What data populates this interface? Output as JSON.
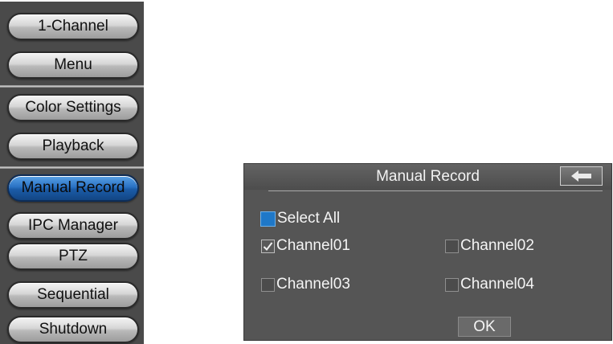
{
  "menu": {
    "items": [
      {
        "label": "1-Channel"
      },
      {
        "label": "Menu"
      },
      {
        "label": "Color Settings"
      },
      {
        "label": "Playback"
      },
      {
        "label": "Manual Record",
        "active": true
      },
      {
        "label": "IPC Manager"
      },
      {
        "label": "PTZ"
      },
      {
        "label": "Sequential"
      },
      {
        "label": "Shutdown"
      }
    ],
    "active_color": "#2a72c4"
  },
  "dialog": {
    "title": "Manual Record",
    "back_icon": "back-arrow-icon",
    "select_all": {
      "label": "Select All",
      "checked": false
    },
    "channels": [
      {
        "label": "Channel01",
        "checked": true
      },
      {
        "label": "Channel02",
        "checked": false
      },
      {
        "label": "Channel03",
        "checked": false
      },
      {
        "label": "Channel04",
        "checked": false
      }
    ],
    "ok_label": "OK"
  }
}
